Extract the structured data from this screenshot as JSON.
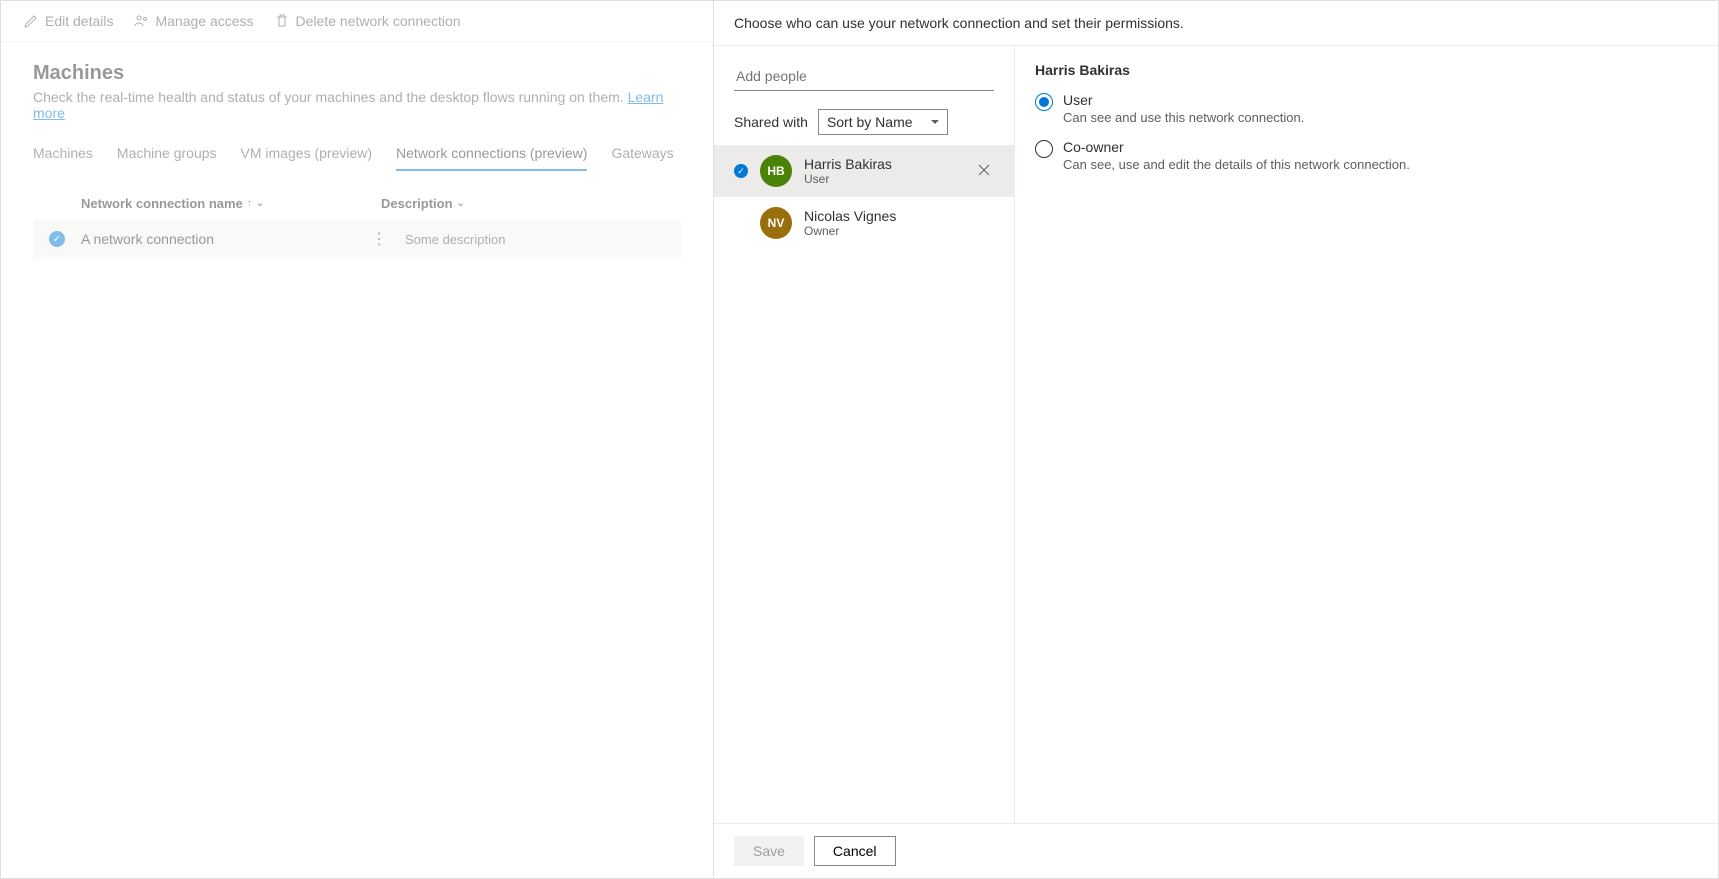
{
  "commandBar": {
    "edit": "Edit details",
    "manage": "Manage access",
    "delete": "Delete network connection"
  },
  "page": {
    "title": "Machines",
    "subtitle": "Check the real-time health and status of your machines and the desktop flows running on them. ",
    "learnMore": "Learn more"
  },
  "tabs": [
    {
      "label": "Machines",
      "active": false
    },
    {
      "label": "Machine groups",
      "active": false
    },
    {
      "label": "VM images (preview)",
      "active": false
    },
    {
      "label": "Network connections (preview)",
      "active": true
    },
    {
      "label": "Gateways",
      "active": false
    }
  ],
  "columns": {
    "name": "Network connection name",
    "sortArrow": "↑",
    "desc": "Description"
  },
  "rows": [
    {
      "name": "A network connection",
      "desc": "Some description"
    }
  ],
  "panel": {
    "header": "Choose who can use your network connection and set their permissions.",
    "addPlaceholder": "Add people",
    "sharedWith": "Shared with",
    "sortBy": "Sort by Name",
    "people": [
      {
        "initials": "HB",
        "name": "Harris Bakiras",
        "role": "User",
        "color": "green",
        "selected": true,
        "removable": true
      },
      {
        "initials": "NV",
        "name": "Nicolas Vignes",
        "role": "Owner",
        "color": "olive",
        "selected": false,
        "removable": false
      }
    ],
    "detail": {
      "name": "Harris Bakiras",
      "options": [
        {
          "label": "User",
          "desc": "Can see and use this network connection.",
          "checked": true
        },
        {
          "label": "Co-owner",
          "desc": "Can see, use and edit the details of this network connection.",
          "checked": false
        }
      ]
    },
    "footer": {
      "save": "Save",
      "cancel": "Cancel"
    }
  }
}
